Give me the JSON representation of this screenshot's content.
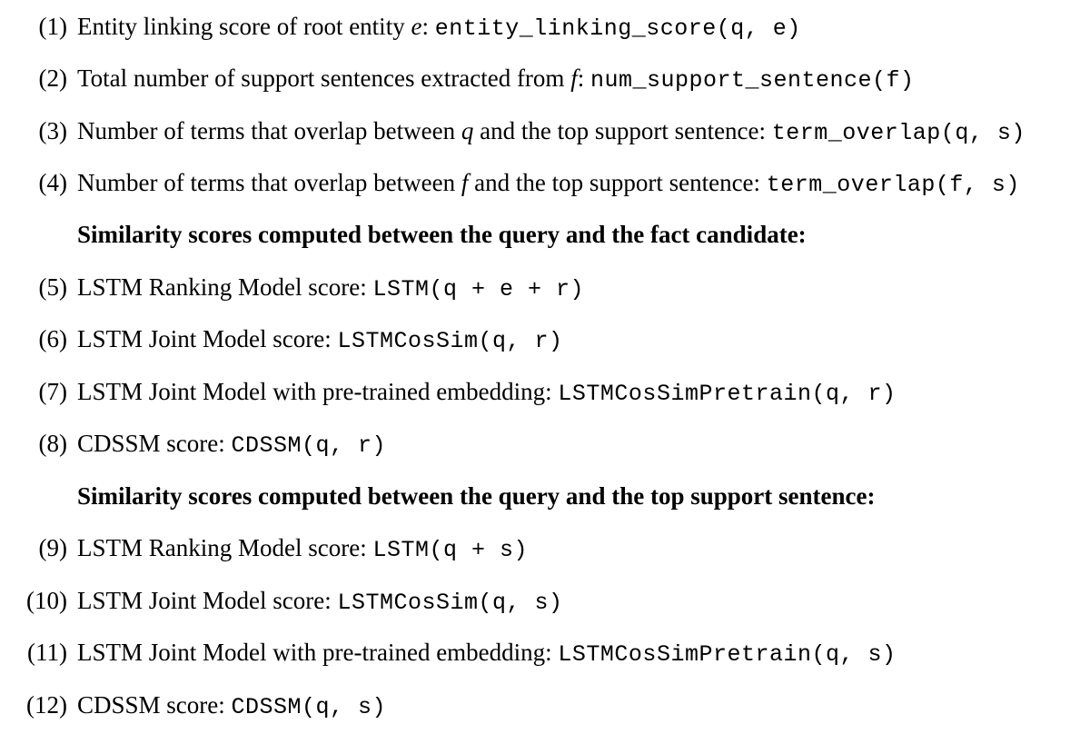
{
  "items": [
    {
      "num": "(1)",
      "before": "Entity linking score of root entity ",
      "var": "e",
      "after": ": ",
      "code": "entity_linking_score(q, e)"
    },
    {
      "num": "(2)",
      "before": "Total number of support sentences extracted from ",
      "var": "f",
      "after": ": ",
      "code": "num_support_sentence(f)"
    },
    {
      "num": "(3)",
      "before": "Number of terms that overlap between ",
      "var": "q",
      "after": " and the top support sentence: ",
      "code": "term_overlap(q, s)"
    },
    {
      "num": "(4)",
      "before": "Number of terms that overlap between ",
      "var": "f",
      "after": " and the top support sentence: ",
      "code": "term_overlap(f, s)"
    },
    {
      "num": "(5)",
      "text": "LSTM Ranking Model score: ",
      "code": "LSTM(q + e + r)"
    },
    {
      "num": "(6)",
      "text": "LSTM Joint Model score: ",
      "code": "LSTMCosSim(q, r)"
    },
    {
      "num": "(7)",
      "text": "LSTM Joint Model with pre-trained embedding: ",
      "code": "LSTMCosSimPretrain(q, r)"
    },
    {
      "num": "(8)",
      "text": "CDSSM score: ",
      "code": "CDSSM(q, r)"
    },
    {
      "num": "(9)",
      "text": "LSTM Ranking Model score: ",
      "code": "LSTM(q + s)"
    },
    {
      "num": "(10)",
      "text": "LSTM Joint Model score: ",
      "code": "LSTMCosSim(q, s)"
    },
    {
      "num": "(11)",
      "text": "LSTM Joint Model with pre-trained embedding: ",
      "code": "LSTMCosSimPretrain(q, s)"
    },
    {
      "num": "(12)",
      "text": "CDSSM score: ",
      "code": "CDSSM(q, s)"
    }
  ],
  "headings": {
    "fact_candidate": "Similarity scores computed between the query and the fact candidate:",
    "support_sentence": "Similarity scores computed between the query and the top support sentence:"
  }
}
